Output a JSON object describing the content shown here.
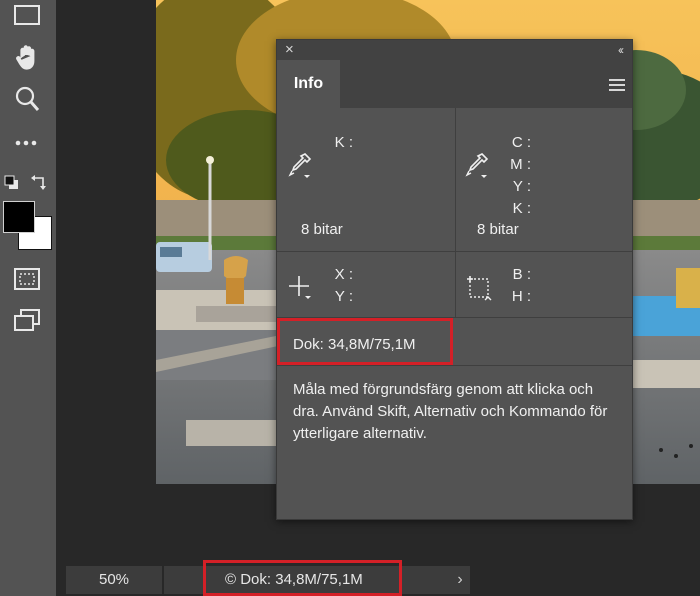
{
  "toolbar": {
    "tools": [
      "marquee-tool",
      "hand-tool",
      "zoom-tool",
      "more-tools",
      "swap-colors",
      "foreground-color",
      "background-color",
      "quick-mask",
      "screen-mode"
    ]
  },
  "info_panel": {
    "tab_label": "Info",
    "close_glyph": "×",
    "collapse_glyph": "‹‹",
    "left_readout": {
      "k_label": "K :",
      "bits": "8 bitar"
    },
    "right_readout": {
      "c_label": "C :",
      "m_label": "M :",
      "y_label": "Y :",
      "k_label": "K :",
      "bits": "8 bitar"
    },
    "position": {
      "x_label": "X :",
      "y_label": "Y :"
    },
    "size": {
      "w_label": "B :",
      "h_label": "H :"
    },
    "doc_size": "Dok: 34,8M/75,1M",
    "description": "Måla med förgrundsfärg genom att klicka och dra. Använd Skift, Alternativ och Kommando för ytterligare alternativ."
  },
  "status_bar": {
    "zoom": "50%",
    "doc_info": "© Dok: 34,8M/75,1M",
    "arrow": "›"
  },
  "colors": {
    "highlight": "#d42027",
    "foreground": "#000000",
    "background": "#ffffff"
  }
}
